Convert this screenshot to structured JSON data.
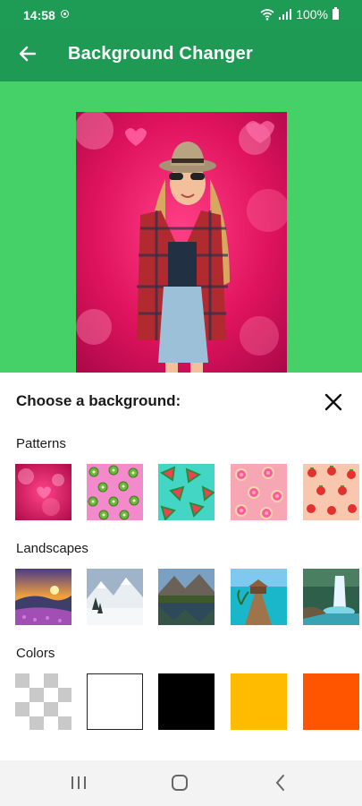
{
  "status_bar": {
    "time": "14:58",
    "battery_percent": "100%"
  },
  "app_bar": {
    "title": "Background Changer"
  },
  "sheet": {
    "title": "Choose a background:",
    "sections": [
      {
        "label": "Patterns",
        "items": [
          "bokeh-hearts",
          "kiwi-pattern",
          "watermelon-pattern",
          "donut-pattern",
          "strawberry-pattern"
        ]
      },
      {
        "label": "Landscapes",
        "items": [
          "sunset-hills",
          "snowy-mountains",
          "mountain-lake",
          "pier-sea",
          "waterfall"
        ]
      },
      {
        "label": "Colors",
        "items": [
          "transparent",
          "white",
          "black",
          "yellow",
          "orange"
        ]
      }
    ]
  },
  "colors": {
    "status_bar": "#1e9b54",
    "app_bar": "#1f9a54",
    "preview_background": "#46d168",
    "color_white": "#ffffff",
    "color_black": "#000000",
    "color_yellow": "#ffbb00",
    "color_orange": "#ff5500"
  }
}
